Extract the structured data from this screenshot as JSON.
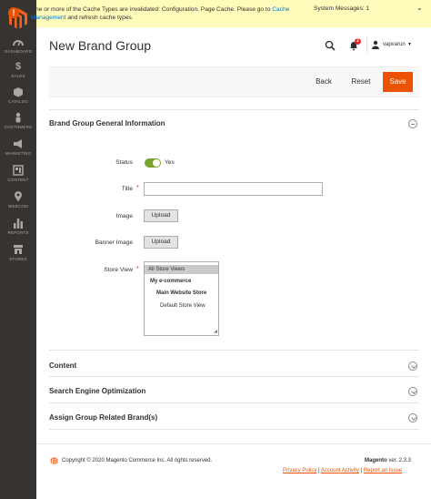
{
  "sidebar": {
    "items": [
      {
        "label": "Dashboard",
        "icon": "dashboard-icon"
      },
      {
        "label": "Sales",
        "icon": "dollar-icon"
      },
      {
        "label": "Catalog",
        "icon": "box-icon"
      },
      {
        "label": "Customers",
        "icon": "person-icon"
      },
      {
        "label": "Marketing",
        "icon": "megaphone-icon"
      },
      {
        "label": "Content",
        "icon": "layout-icon"
      },
      {
        "label": "Webcom",
        "icon": "pin-icon"
      },
      {
        "label": "Reports",
        "icon": "bar-chart-icon"
      },
      {
        "label": "Stores",
        "icon": "store-icon"
      }
    ]
  },
  "message": {
    "text_before": "One or more of the Cache Types are invalidated: Configuration, Page Cache. Please go to ",
    "link": "Cache Management",
    "text_after": " and refresh cache types.",
    "system_messages": "System Messages: 1"
  },
  "header": {
    "title": "New Brand Group",
    "notification_count": "2",
    "username": "vapvarun"
  },
  "actions": {
    "back": "Back",
    "reset": "Reset",
    "save": "Save"
  },
  "general": {
    "title": "Brand Group General Information",
    "status_label": "Status",
    "status_value": "Yes",
    "title_label": "Title",
    "title_value": "",
    "image_label": "Image",
    "banner_label": "Banner Image",
    "upload": "Upload",
    "store_view_label": "Store View",
    "store_options": [
      "All Store Views",
      "My e-commerce",
      "Main Website Store",
      "Default Store View"
    ]
  },
  "sections": {
    "content": "Content",
    "seo": "Search Engine Optimization",
    "assign": "Assign Group Related Brand(s)"
  },
  "footer": {
    "copyright": "Copyright © 2020 Magento Commerce Inc. All rights reserved.",
    "brand": "Magento",
    "version": " ver. 2.3.3",
    "privacy": "Privacy Policy",
    "activity": "Account Activity",
    "report": "Report an Issue",
    "sep": " | "
  },
  "colors": {
    "accent": "#eb5202",
    "sidebar": "#373330",
    "toggle_on": "#79a22e",
    "message_bg": "#fffbbb"
  }
}
